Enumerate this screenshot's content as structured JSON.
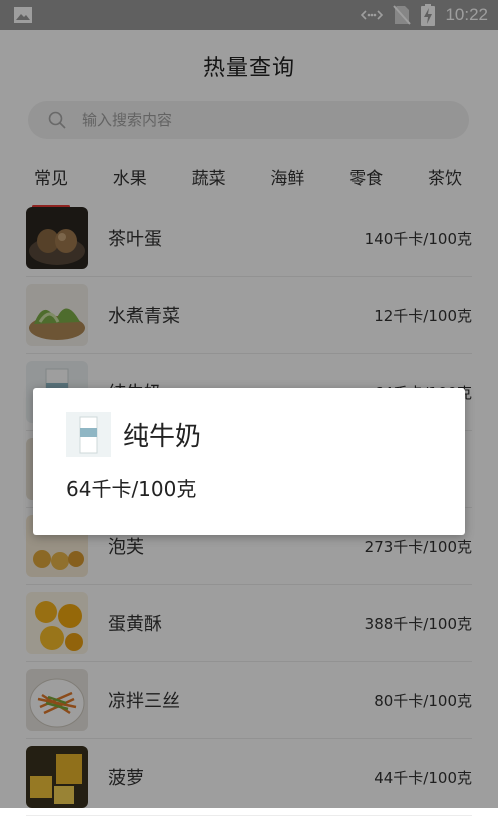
{
  "status_bar": {
    "time": "10:22",
    "icons": [
      "image-icon",
      "data-transfer-icon",
      "no-sim-icon",
      "battery-charging-icon"
    ]
  },
  "app": {
    "title": "热量查询",
    "search": {
      "placeholder": "输入搜索内容"
    },
    "tabs": [
      {
        "label": "常见",
        "active": true
      },
      {
        "label": "水果",
        "active": false
      },
      {
        "label": "蔬菜",
        "active": false
      },
      {
        "label": "海鲜",
        "active": false
      },
      {
        "label": "零食",
        "active": false
      },
      {
        "label": "茶饮",
        "active": false
      }
    ],
    "items": [
      {
        "name": "茶叶蛋",
        "calories": "140千卡/100克",
        "image": "tea-egg-image"
      },
      {
        "name": "水煮青菜",
        "calories": "12千卡/100克",
        "image": "boiled-greens-image"
      },
      {
        "name": "纯牛奶",
        "calories": "64千卡/100克",
        "image": "milk-image"
      },
      {
        "name": "",
        "calories": "",
        "image": "hidden-item-image"
      },
      {
        "name": "泡芙",
        "calories": "273千卡/100克",
        "image": "puff-image"
      },
      {
        "name": "蛋黄酥",
        "calories": "388千卡/100克",
        "image": "egg-yolk-pastry-image"
      },
      {
        "name": "凉拌三丝",
        "calories": "80千卡/100克",
        "image": "cold-salad-image"
      },
      {
        "name": "菠萝",
        "calories": "44千卡/100克",
        "image": "pineapple-image"
      }
    ]
  },
  "dialog": {
    "title": "纯牛奶",
    "calories": "64千卡/100克",
    "image": "milk-image"
  },
  "colors": {
    "status_bar": "#9c9c9c",
    "overlay": "rgba(0,0,0,0.38)",
    "tab_indicator": "#e53935"
  }
}
